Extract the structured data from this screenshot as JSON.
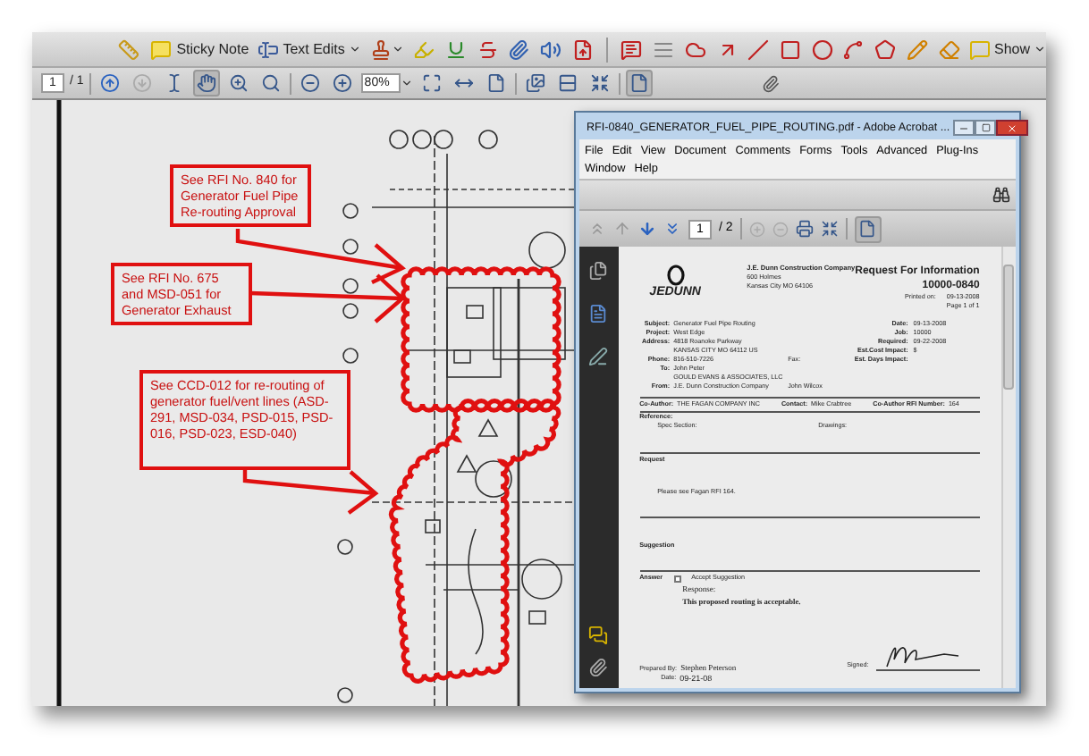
{
  "toolbar": {
    "items": [
      {
        "kind": "icon"
      },
      {
        "kind": "labeled",
        "label": "Sticky Note"
      },
      {
        "kind": "menu",
        "label": "Text Edits"
      },
      {
        "kind": "icon-menu"
      },
      {
        "kind": "icon"
      },
      {
        "kind": "icon"
      },
      {
        "kind": "icon"
      },
      {
        "kind": "icon"
      },
      {
        "kind": "icon"
      },
      {
        "kind": "icon"
      },
      {
        "kind": "separator"
      },
      {
        "kind": "icon"
      },
      {
        "kind": "icon"
      },
      {
        "kind": "icon"
      },
      {
        "kind": "icon"
      },
      {
        "kind": "icon"
      },
      {
        "kind": "icon"
      },
      {
        "kind": "icon"
      },
      {
        "kind": "icon"
      },
      {
        "kind": "icon"
      },
      {
        "kind": "icon"
      },
      {
        "kind": "icon"
      },
      {
        "kind": "menu",
        "label": "Show"
      }
    ]
  },
  "nav_toolbar": {
    "page_number": "1",
    "page_count": "/ 1",
    "zoom": "80%",
    "tools": [
      {
        "selected": false,
        "disabled": false
      },
      {
        "selected": false,
        "disabled": true
      },
      {
        "selected": false,
        "disabled": false
      },
      {
        "selected": true,
        "disabled": false
      },
      {
        "selected": false,
        "disabled": false
      },
      {
        "selected": false,
        "disabled": false
      },
      {
        "selected": false,
        "disabled": false
      },
      {
        "selected": false,
        "disabled": false
      }
    ],
    "view_tools": [
      {
        "selected": false
      },
      {
        "selected": false
      },
      {
        "selected": false
      },
      {
        "selected": false
      },
      {
        "selected": false
      },
      {
        "selected": false
      },
      {
        "selected": true
      }
    ]
  },
  "callouts": [
    "See RFI No. 840 for Generator Fuel Pipe Re-routing Approval",
    "See RFI No. 675 and MSD-051 for Generator Exhaust",
    "See CCD-012 for  re-routing of generator fuel/vent lines (ASD-291, MSD-034, PSD-015, PSD-016, PSD-023, ESD-040)"
  ],
  "document_window": {
    "title": "RFI-0840_GENERATOR_FUEL_PIPE_ROUTING.pdf - Adobe Acrobat ...",
    "menu": [
      "File",
      "Edit",
      "View",
      "Document",
      "Comments",
      "Forms",
      "Tools",
      "Advanced",
      "Plug-Ins",
      "Window",
      "Help"
    ],
    "page_number": "1",
    "page_count": "/ 2",
    "rfi": {
      "logo": "JEDUNN",
      "company": "J.E. Dunn Construction Company",
      "address": [
        "600 Holmes",
        "Kansas City MO 64106"
      ],
      "title": "Request For Information",
      "number": "10000-0840",
      "printed_label": "Printed on:",
      "printed": "09-13-2008",
      "page": "Page 1 of 1",
      "left_fields": [
        {
          "label": "Subject:",
          "lines": [
            "Generator Fuel Pipe Routing"
          ]
        },
        {
          "label": "Project:",
          "lines": [
            "West Edge"
          ]
        },
        {
          "label": "Address:",
          "lines": [
            "4818 Roanoke Parkway",
            "KANSAS CITY MO 64112 US"
          ]
        },
        {
          "label": "Phone:",
          "lines": [
            "816-510-7226"
          ],
          "aside": "Fax:"
        },
        {
          "label": "To:",
          "lines": [
            "John Peter",
            "GOULD EVANS & ASSOCIATES, LLC"
          ]
        },
        {
          "label": "From:",
          "lines": [
            "J.E. Dunn Construction Company"
          ],
          "aside": "John Wilcox"
        }
      ],
      "right_fields": [
        {
          "label": "Date:",
          "value": "09-13-2008"
        },
        {
          "label": "Job:",
          "value": "10000"
        },
        {
          "label": "Required:",
          "value": "09-22-2008"
        },
        {
          "label": "Est.Cost Impact:",
          "value": "$"
        },
        {
          "label": "Est. Days Impact:"
        }
      ],
      "co_author": [
        {
          "label": "Co-Author:",
          "value": "THE FAGAN COMPANY INC"
        },
        {
          "label": "Contact:",
          "value": "Mike Crabtree"
        },
        {
          "label": "Co-Author RFI Number:",
          "value": "164"
        }
      ],
      "reference_label": "Reference:",
      "spec_label": "Spec Section:",
      "drawings_label": "Drawings:",
      "request_label": "Request",
      "request": "Please see Fagan RFI 164.",
      "suggestion_label": "Suggestion",
      "answer_label": "Answer",
      "accept": {
        "label": "Accept Suggestion",
        "checked": false
      },
      "response_label": "Response:",
      "response": "This proposed routing is acceptable.",
      "prepared_label": "Prepared By:",
      "prepared_by": "Stephen Peterson",
      "date_label": "Date:",
      "date": "09-21-08",
      "signed_label": "Signed:"
    }
  }
}
